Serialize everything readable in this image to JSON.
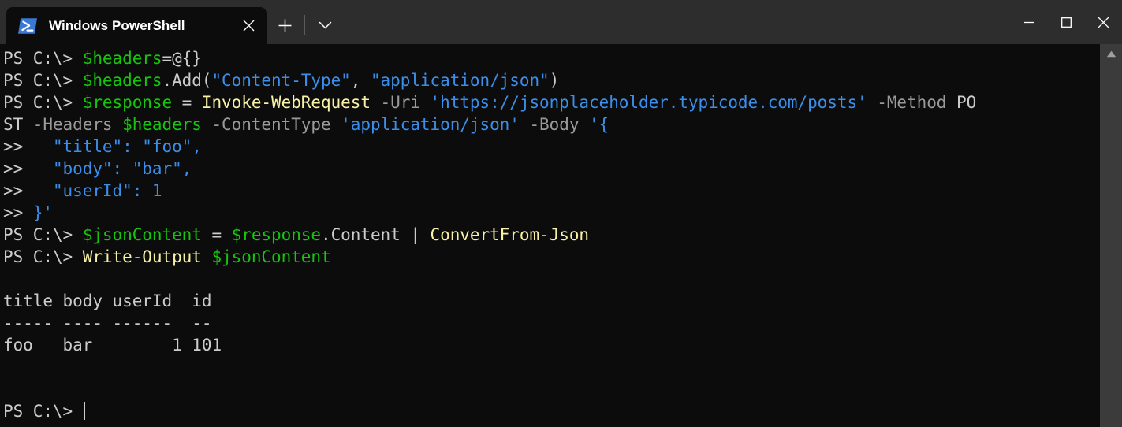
{
  "window": {
    "titlebar": {
      "tab": {
        "icon": "powershell-icon",
        "title": "Windows PowerShell",
        "close_label": "✕"
      },
      "new_tab_label": "＋",
      "tab_menu_label": "⌄",
      "controls": {
        "minimize_label": "—",
        "maximize_label": "☐",
        "close_label": "✕"
      }
    },
    "colors": {
      "titlebar_bg": "#2d2d2d",
      "terminal_bg": "#0c0c0c",
      "tab_bg": "#0c0c0c",
      "accent_blue": "#3b8eea",
      "variable_green": "#16c60c",
      "cmdlet_yellow": "#f9f1a5",
      "parameter_gray": "#9a9a9a",
      "default_text": "#cccccc",
      "scrollbar_bg": "#3b3b3b"
    }
  },
  "terminal": {
    "prompt": "PS C:\\> ",
    "continuation_prompt": ">> ",
    "lines": [
      {
        "type": "command",
        "segments": [
          {
            "text": "PS C:\\> ",
            "color": "prompt"
          },
          {
            "text": "$headers",
            "color": "var"
          },
          {
            "text": "=@{}",
            "color": "default"
          }
        ]
      },
      {
        "type": "command",
        "segments": [
          {
            "text": "PS C:\\> ",
            "color": "prompt"
          },
          {
            "text": "$headers",
            "color": "var"
          },
          {
            "text": ".Add(",
            "color": "default"
          },
          {
            "text": "\"Content-Type\"",
            "color": "string"
          },
          {
            "text": ", ",
            "color": "default"
          },
          {
            "text": "\"application/json\"",
            "color": "string"
          },
          {
            "text": ")",
            "color": "default"
          }
        ]
      },
      {
        "type": "command",
        "segments": [
          {
            "text": "PS C:\\> ",
            "color": "prompt"
          },
          {
            "text": "$response",
            "color": "var"
          },
          {
            "text": " = ",
            "color": "default"
          },
          {
            "text": "Invoke-WebRequest",
            "color": "cmd"
          },
          {
            "text": " -Uri ",
            "color": "param"
          },
          {
            "text": "'https://jsonplaceholder.typicode.com/posts'",
            "color": "string"
          },
          {
            "text": " -Method ",
            "color": "param"
          },
          {
            "text": "PO",
            "color": "default"
          }
        ]
      },
      {
        "type": "command-wrap",
        "segments": [
          {
            "text": "ST",
            "color": "default"
          },
          {
            "text": " -Headers ",
            "color": "param"
          },
          {
            "text": "$headers",
            "color": "var"
          },
          {
            "text": " -ContentType ",
            "color": "param"
          },
          {
            "text": "'application/json'",
            "color": "string"
          },
          {
            "text": " -Body ",
            "color": "param"
          },
          {
            "text": "'{",
            "color": "string"
          }
        ]
      },
      {
        "type": "continuation",
        "segments": [
          {
            "text": ">> ",
            "color": "cont"
          },
          {
            "text": "  \"title\": \"foo\",",
            "color": "string"
          }
        ]
      },
      {
        "type": "continuation",
        "segments": [
          {
            "text": ">> ",
            "color": "cont"
          },
          {
            "text": "  \"body\": \"bar\",",
            "color": "string"
          }
        ]
      },
      {
        "type": "continuation",
        "segments": [
          {
            "text": ">> ",
            "color": "cont"
          },
          {
            "text": "  \"userId\": 1",
            "color": "string"
          }
        ]
      },
      {
        "type": "continuation",
        "segments": [
          {
            "text": ">> ",
            "color": "cont"
          },
          {
            "text": "}'",
            "color": "string"
          }
        ]
      },
      {
        "type": "command",
        "segments": [
          {
            "text": "PS C:\\> ",
            "color": "prompt"
          },
          {
            "text": "$jsonContent",
            "color": "var"
          },
          {
            "text": " = ",
            "color": "default"
          },
          {
            "text": "$response",
            "color": "var"
          },
          {
            "text": ".Content | ",
            "color": "default"
          },
          {
            "text": "ConvertFrom-Json",
            "color": "cmd"
          }
        ]
      },
      {
        "type": "command",
        "segments": [
          {
            "text": "PS C:\\> ",
            "color": "prompt"
          },
          {
            "text": "Write-Output",
            "color": "cmd"
          },
          {
            "text": " ",
            "color": "default"
          },
          {
            "text": "$jsonContent",
            "color": "var"
          }
        ]
      },
      {
        "type": "blank",
        "segments": [
          {
            "text": "",
            "color": "default"
          }
        ]
      },
      {
        "type": "output",
        "segments": [
          {
            "text": "title body userId  id",
            "color": "out"
          }
        ]
      },
      {
        "type": "output",
        "segments": [
          {
            "text": "----- ---- ------  --",
            "color": "out"
          }
        ]
      },
      {
        "type": "output",
        "segments": [
          {
            "text": "foo   bar        1 101",
            "color": "out"
          }
        ]
      },
      {
        "type": "blank",
        "segments": [
          {
            "text": "",
            "color": "default"
          }
        ]
      },
      {
        "type": "blank",
        "segments": [
          {
            "text": "",
            "color": "default"
          }
        ]
      },
      {
        "type": "prompt-active",
        "segments": [
          {
            "text": "PS C:\\> ",
            "color": "prompt"
          }
        ],
        "cursor": true
      }
    ],
    "output_table": {
      "type": "table",
      "headers": [
        "title",
        "body",
        "userId",
        "id"
      ],
      "separators": [
        "-----",
        "----",
        "------",
        "--"
      ],
      "rows": [
        {
          "title": "foo",
          "body": "bar",
          "userId": "1",
          "id": "101"
        }
      ]
    }
  },
  "scrollbar": {
    "up_arrow_label": "▲",
    "position": "top"
  }
}
